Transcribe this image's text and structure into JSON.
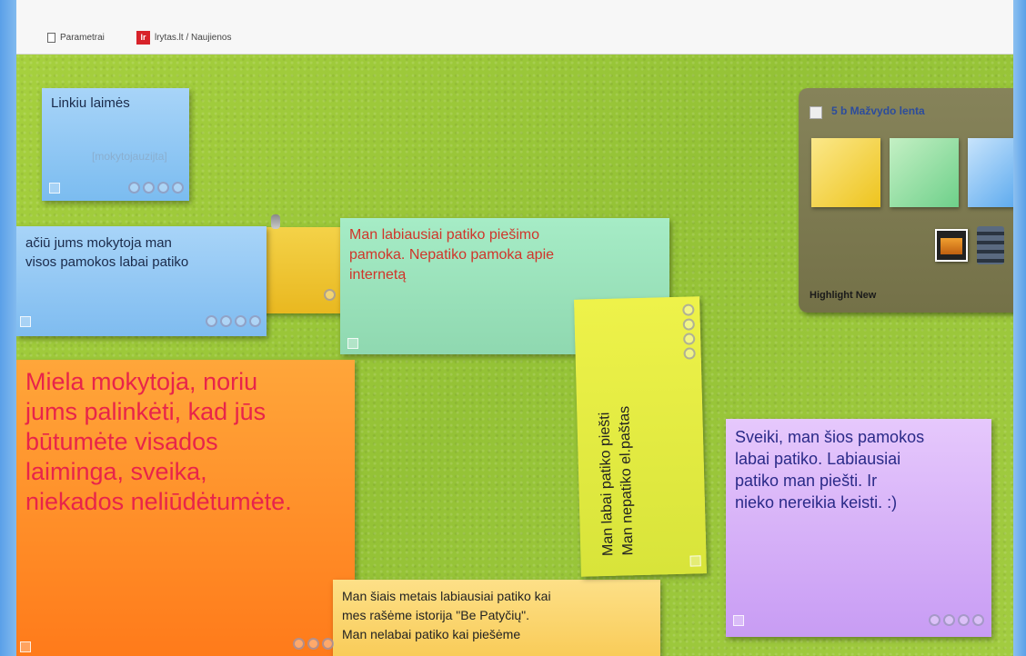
{
  "bookmarks": {
    "items": [
      {
        "label": "Parametrai",
        "icon": "document-icon"
      },
      {
        "label": "lrytas.lt / Naujienos",
        "icon": "lr-logo-icon",
        "logo_text": "lr"
      }
    ]
  },
  "board": {
    "background_color": "#9dc93a",
    "notes": [
      {
        "id": "n1",
        "text": "Linkiu laimės",
        "signature": "[mokytojauzijta]",
        "color": "#a8d4f8"
      },
      {
        "id": "n2",
        "text": "ačiū jums mokytoja man\nvisos pamokos labai patiko",
        "color": "#a8d4f8"
      },
      {
        "id": "n3",
        "text": "",
        "color": "#f4d248"
      },
      {
        "id": "n4",
        "text": "Man labiausiai patiko piešimo\npamoka. Nepatiko pamoka apie\ninternetą",
        "color": "#a6ecc6",
        "text_color": "#d0352a"
      },
      {
        "id": "n5",
        "text": "Man labai patiko piešti\nMan nepatiko el.paštas",
        "color": "#eef24a"
      },
      {
        "id": "n6",
        "text": "Miela mokytoja, noriu\njums palinkėti, kad jūs\nbūtumėte visados\nlaiminga, sveika,\nniekados neliūdėtumėte.",
        "color": "#ffa63a",
        "text_color": "#e8244a"
      },
      {
        "id": "n7",
        "text": "Sveiki, man šios pamokos\nlabai patiko. Labiausiai\npatiko man piešti. Ir\nnieko nereikia keisti. :)",
        "color": "#e6c8fc",
        "text_color": "#2a2a88"
      },
      {
        "id": "n8",
        "text": "Man šiais metais labiausiai patiko kai\nmes rašėme istorija \"Be Patyčių\".\nMan nelabai patiko kai piešėme",
        "color": "#fde088"
      }
    ]
  },
  "palette": {
    "title": "5 b Mažvydo lenta",
    "highlight_label": "Highlight New",
    "swatches": [
      "yellow",
      "green",
      "blue"
    ],
    "tools": [
      "image-icon",
      "film-icon"
    ]
  }
}
